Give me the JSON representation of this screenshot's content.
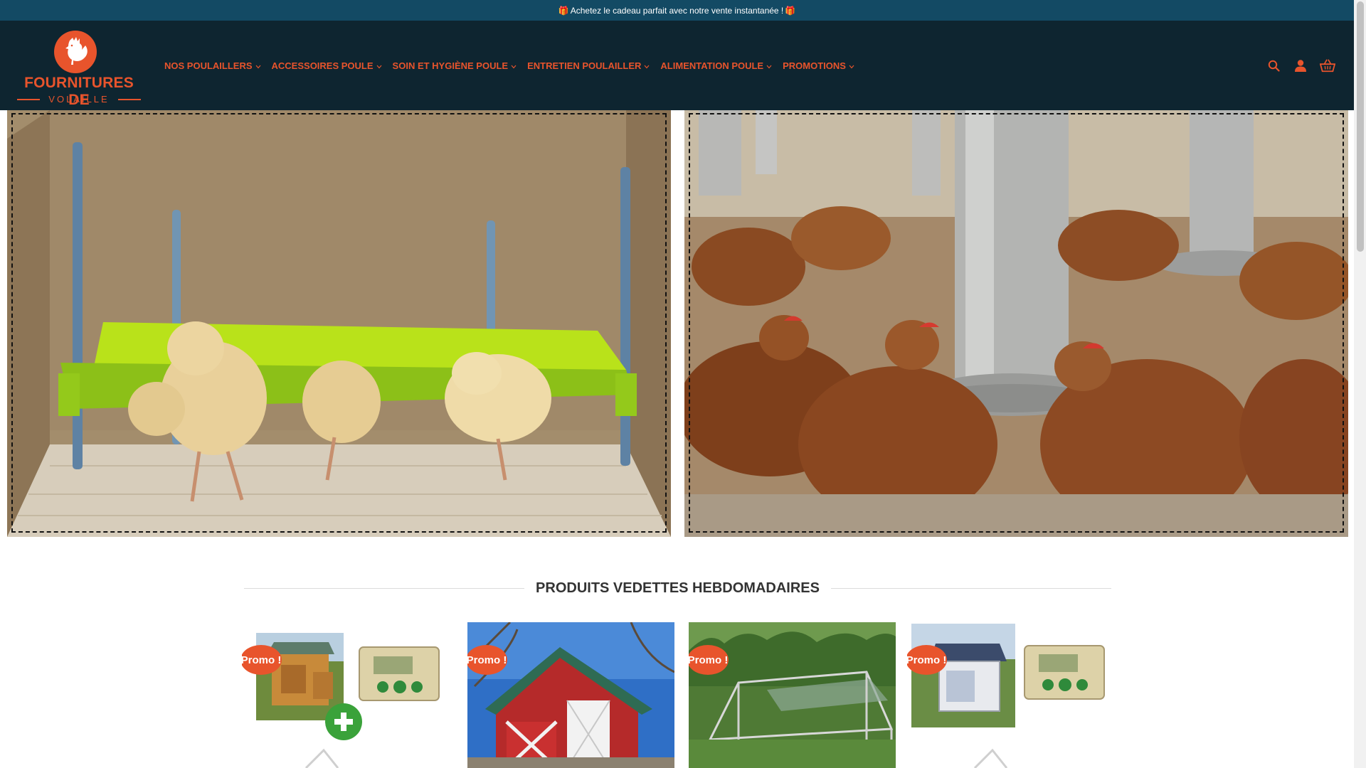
{
  "announcement": {
    "gift_icon": "gift-icon",
    "text": "Achetez le cadeau parfait avec notre vente instantanée !"
  },
  "brand": {
    "name_line1": "FOURNITURES DE",
    "name_line2": "VOLAILLE",
    "accent_color": "#e8542c",
    "header_bg": "#0e2530",
    "topbar_bg": "#134a64"
  },
  "nav": {
    "items": [
      {
        "label": "NOS POULAILLERS"
      },
      {
        "label": "ACCESSOIRES POULE"
      },
      {
        "label": "SOIN ET HYGIÈNE POULE"
      },
      {
        "label": "ENTRETIEN POULAILLER"
      },
      {
        "label": "ALIMENTATION POULE"
      },
      {
        "label": "PROMOTIONS"
      }
    ]
  },
  "header_icons": [
    "search-icon",
    "account-icon",
    "cart-icon"
  ],
  "featured": {
    "title": "PRODUITS VEDETTES HEBDOMADAIRES",
    "products": [
      {
        "badge": "Promo !"
      },
      {
        "badge": "Promo !"
      },
      {
        "badge": "Promo !"
      },
      {
        "badge": "Promo !"
      }
    ]
  }
}
